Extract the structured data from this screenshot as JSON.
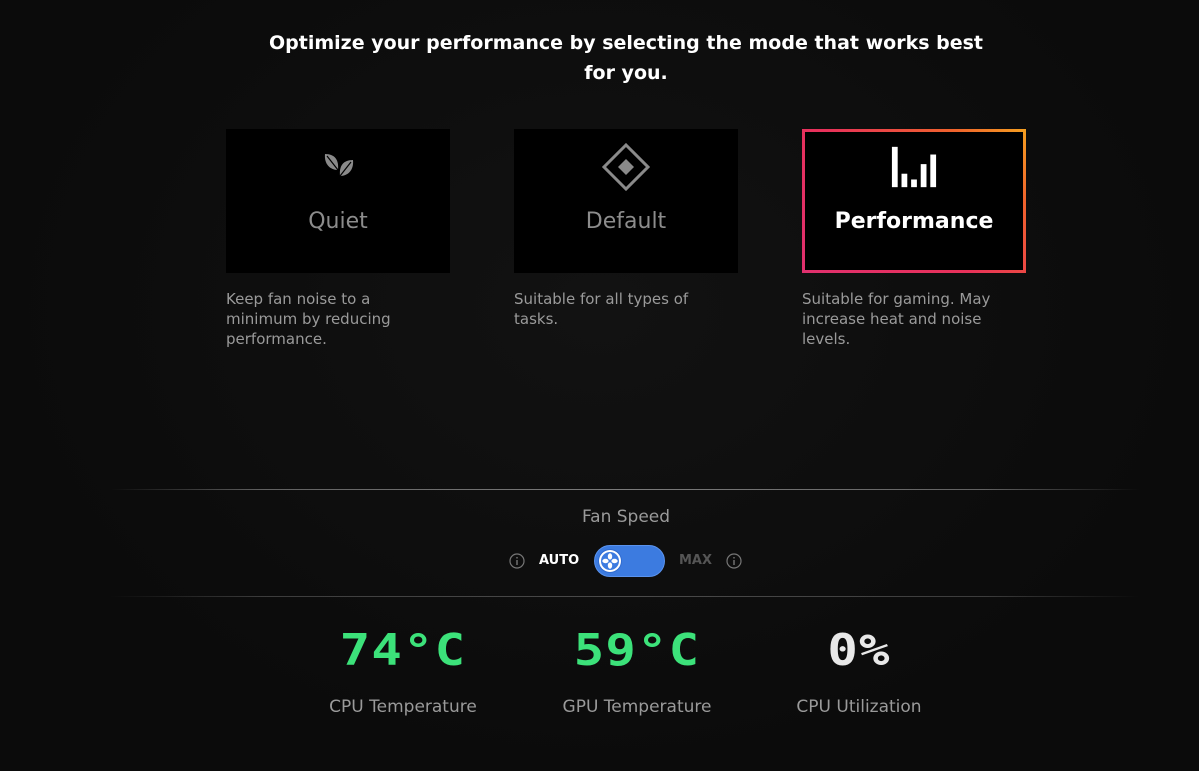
{
  "headline": "Optimize your performance by selecting the mode that works best for you.",
  "modes": [
    {
      "id": "quiet",
      "label": "Quiet",
      "icon": "leaf-icon",
      "description": "Keep fan noise to a minimum by reducing performance.",
      "selected": false
    },
    {
      "id": "default",
      "label": "Default",
      "icon": "diamond-icon",
      "description": "Suitable for all types of tasks.",
      "selected": false
    },
    {
      "id": "performance",
      "label": "Performance",
      "icon": "bars-icon",
      "description": "Suitable for gaming. May increase heat and noise levels.",
      "selected": true
    }
  ],
  "fan_speed": {
    "title": "Fan Speed",
    "auto_label": "AUTO",
    "max_label": "MAX",
    "mode": "AUTO",
    "toggle_color": "#3c7be0"
  },
  "stats": [
    {
      "value": "74°C",
      "label": "CPU Temperature",
      "color": "#3ce27a"
    },
    {
      "value": "59°C",
      "label": "GPU Temperature",
      "color": "#3ce27a"
    },
    {
      "value": "0%",
      "label": "CPU Utilization",
      "color": "#e8e8e8"
    }
  ],
  "colors": {
    "background": "#0c0c0c",
    "selected_border_start": "#e0306e",
    "selected_border_end": "#f5a020",
    "accent_green": "#3ce27a"
  }
}
